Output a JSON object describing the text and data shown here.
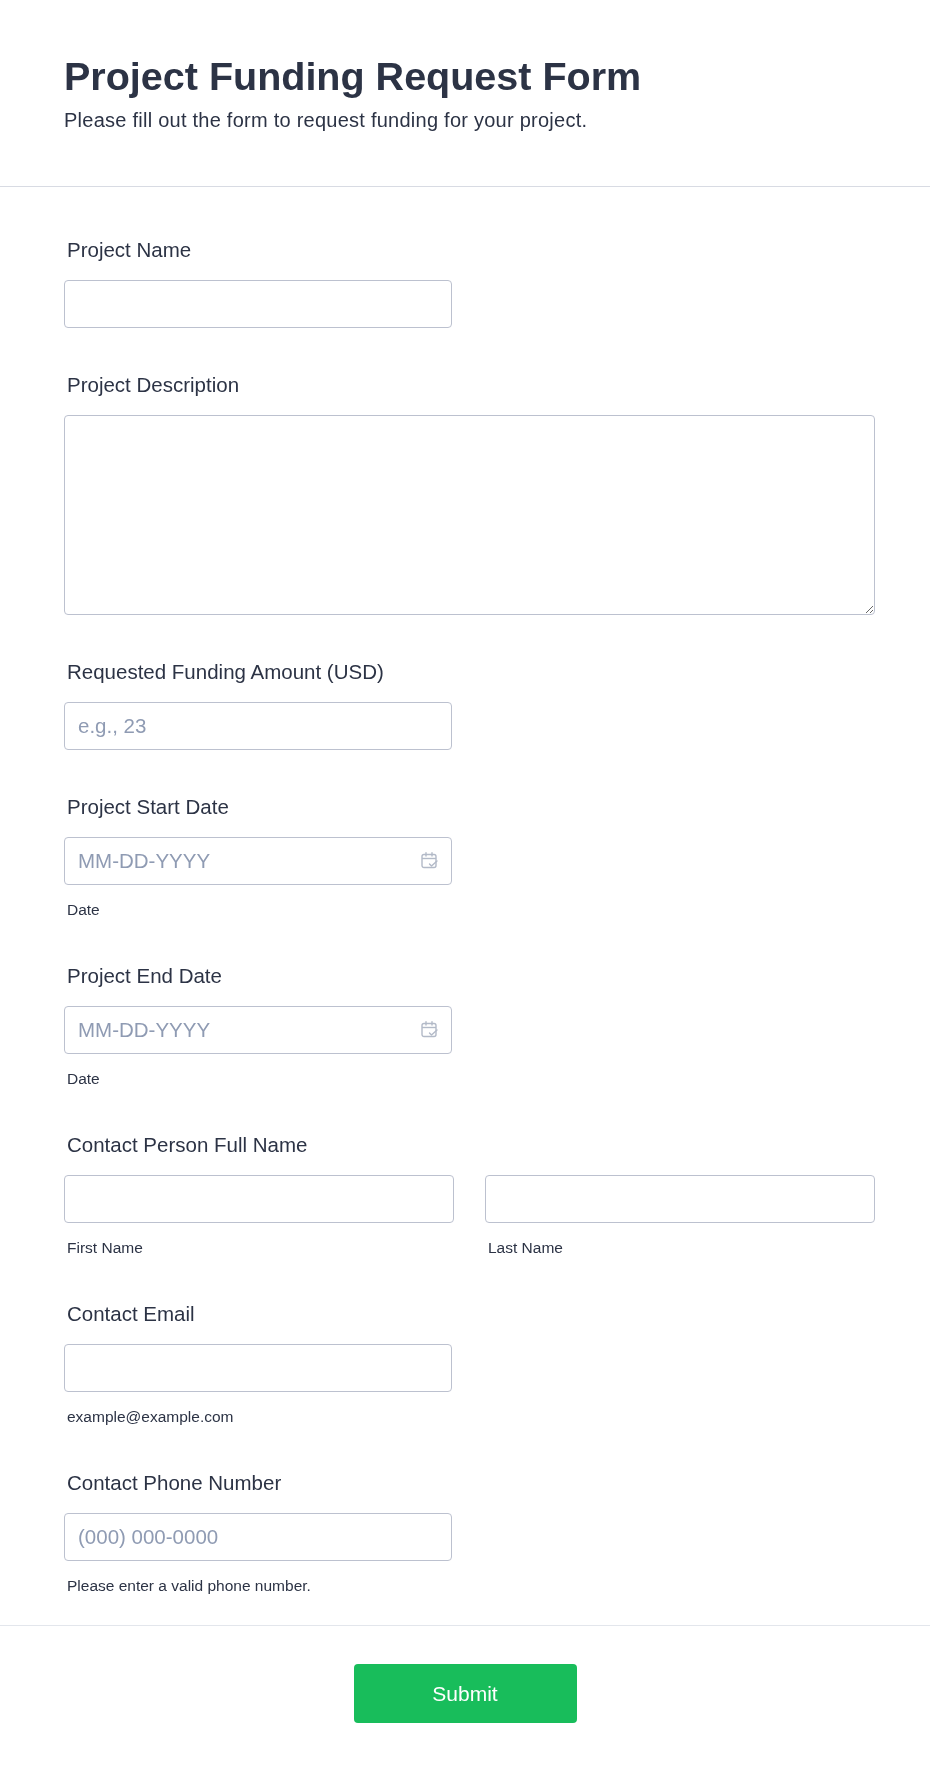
{
  "header": {
    "title": "Project Funding Request Form",
    "subtitle": "Please fill out the form to request funding for your project."
  },
  "fields": [
    {
      "kind": "text",
      "label": "Project Name"
    },
    {
      "kind": "textarea",
      "label": "Project Description"
    },
    {
      "kind": "text",
      "label": "Requested Funding Amount (USD)",
      "placeholder": "e.g., 23"
    },
    {
      "kind": "date",
      "label": "Project Start Date",
      "placeholder": "MM-DD-YYYY",
      "sublabel": "Date"
    },
    {
      "kind": "date",
      "label": "Project End Date",
      "placeholder": "MM-DD-YYYY",
      "sublabel": "Date"
    },
    {
      "kind": "name",
      "label": "Contact Person Full Name",
      "parts": [
        {
          "sublabel": "First Name"
        },
        {
          "sublabel": "Last Name"
        }
      ]
    },
    {
      "kind": "text",
      "label": "Contact Email",
      "sublabel": "example@example.com"
    },
    {
      "kind": "text",
      "label": "Contact Phone Number",
      "placeholder": "(000) 000-0000",
      "sublabel": "Please enter a valid phone number."
    }
  ],
  "submit": {
    "label": "Submit"
  }
}
